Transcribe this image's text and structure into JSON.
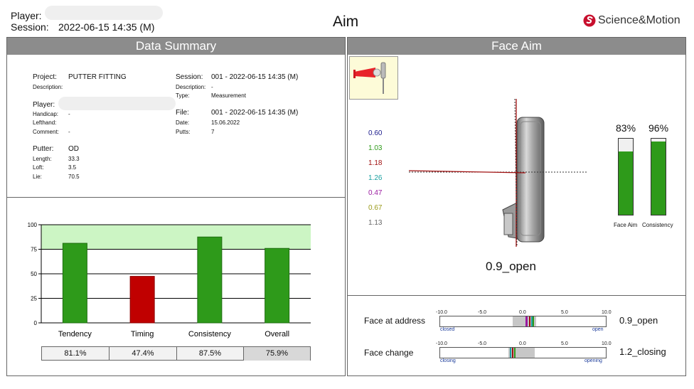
{
  "header": {
    "player_label": "Player:",
    "session_label": "Session:",
    "session_value": "2022-06-15 14:35 (M)",
    "title": "Aim",
    "brand": "Science&Motion"
  },
  "summary": {
    "title": "Data Summary",
    "project_label": "Project:",
    "project_value": "PUTTER FITTING",
    "description_label": "Description:",
    "player_label": "Player:",
    "handicap_label": "Handicap:",
    "handicap_value": "-",
    "lefthand_label": "Lefthand:",
    "comment_label": "Comment:",
    "comment_value": "-",
    "putter_label": "Putter:",
    "putter_value": "OD",
    "length_label": "Length:",
    "length_value": "33.3",
    "loft_label": "Loft:",
    "loft_value": "3.5",
    "lie_label": "Lie:",
    "lie_value": "70.5",
    "session_label": "Session:",
    "session_value": "001 -  2022-06-15 14:35 (M)",
    "session_desc_label": "Description:",
    "session_desc_value": "-",
    "type_label": "Type:",
    "type_value": "Measurement",
    "file_label": "File:",
    "file_value": "001 -  2022-06-15 14:35 (M)",
    "date_label": "Date:",
    "date_value": "15.06.2022",
    "putts_label": "Putts:",
    "putts_value": "7"
  },
  "chart_data": {
    "type": "bar",
    "categories": [
      "Tendency",
      "Timing",
      "Consistency",
      "Overall"
    ],
    "values": [
      81.1,
      47.4,
      87.5,
      75.9
    ],
    "value_labels": [
      "81.1%",
      "47.4%",
      "87.5%",
      "75.9%"
    ],
    "colors": [
      "#2e9a1a",
      "#c00000",
      "#2e9a1a",
      "#2e9a1a"
    ],
    "ylim": [
      0,
      100
    ],
    "yticks": [
      "0",
      "25",
      "50",
      "75",
      "100"
    ],
    "green_zone": [
      75,
      100
    ],
    "grid": true
  },
  "face_aim": {
    "title": "Face Aim",
    "putt_values": [
      {
        "v": "0.60",
        "color": "#1a1a8c"
      },
      {
        "v": "1.03",
        "color": "#2e9a1a"
      },
      {
        "v": "1.18",
        "color": "#a01010"
      },
      {
        "v": "1.26",
        "color": "#1aa0a0"
      },
      {
        "v": "0.47",
        "color": "#9a1aa0"
      },
      {
        "v": "0.67",
        "color": "#9a9a1a"
      },
      {
        "v": "1.13",
        "color": "#666666"
      }
    ],
    "face_aim_pct": "83%",
    "face_aim_pct_value": 83,
    "consistency_pct": "96%",
    "consistency_pct_value": 96,
    "face_aim_label": "Face Aim",
    "consistency_label": "Consistency",
    "result": "0.9_open"
  },
  "scales": {
    "ticks": [
      "-10.0",
      "-5.0",
      "0.0",
      "5.0",
      "10.0"
    ],
    "address_label": "Face at address",
    "address_left": "closed",
    "address_right": "open",
    "address_value": "0.9_open",
    "change_label": "Face change",
    "change_left": "closing",
    "change_right": "opening",
    "change_value": "1.2_closing"
  }
}
